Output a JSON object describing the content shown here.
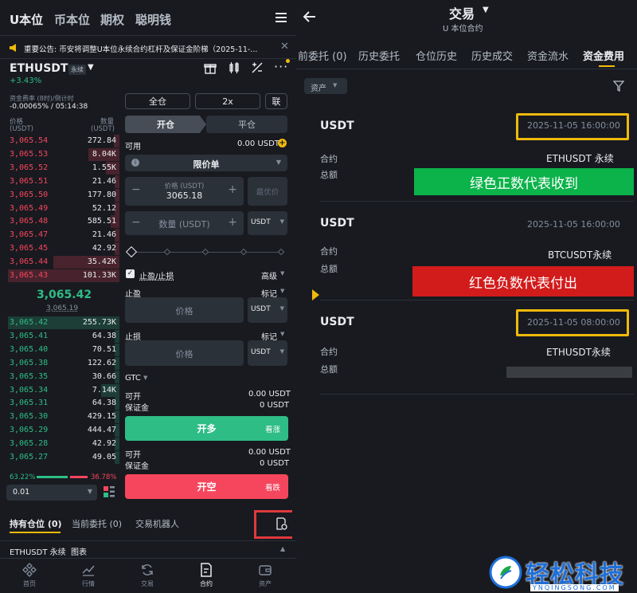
{
  "left": {
    "top_tabs": [
      "U本位",
      "币本位",
      "期权",
      "聪明钱"
    ],
    "announcement": "重要公告: 币安将调整U本位永续合约杠杆及保证金阶梯（2025-11-...",
    "symbol": "ETHUSDT",
    "symbol_badge": "永续",
    "change": "+3.43%",
    "funding_label": "资金费率 (8时)/倒计时",
    "funding_value": "-0.00065% / 05:14:38",
    "col_price": "价格",
    "col_price_unit": "(USDT)",
    "col_qty": "数量",
    "col_qty_unit": "(USDT)",
    "asks": [
      {
        "p": "3,065.54",
        "q": "272.84"
      },
      {
        "p": "3,065.53",
        "q": "8.04K"
      },
      {
        "p": "3,065.52",
        "q": "1.55K"
      },
      {
        "p": "3,065.51",
        "q": "21.46"
      },
      {
        "p": "3,065.50",
        "q": "177.80"
      },
      {
        "p": "3,065.49",
        "q": "52.12"
      },
      {
        "p": "3,065.48",
        "q": "585.51"
      },
      {
        "p": "3,065.47",
        "q": "21.46"
      },
      {
        "p": "3,065.45",
        "q": "42.92"
      },
      {
        "p": "3,065.44",
        "q": "35.42K"
      },
      {
        "p": "3,065.43",
        "q": "101.33K"
      }
    ],
    "mid_price": "3,065.42",
    "mark_price": "3,065.19",
    "bids": [
      {
        "p": "3,065.42",
        "q": "255.73K"
      },
      {
        "p": "3,065.41",
        "q": "64.38"
      },
      {
        "p": "3,065.40",
        "q": "70.51"
      },
      {
        "p": "3,065.38",
        "q": "122.62"
      },
      {
        "p": "3,065.35",
        "q": "30.66"
      },
      {
        "p": "3,065.34",
        "q": "7.14K"
      },
      {
        "p": "3,065.31",
        "q": "64.38"
      },
      {
        "p": "3,065.30",
        "q": "429.15"
      },
      {
        "p": "3,065.29",
        "q": "444.47"
      },
      {
        "p": "3,065.28",
        "q": "42.92"
      },
      {
        "p": "3,065.27",
        "q": "49.05"
      }
    ],
    "buy_ratio": "63.22%",
    "sell_ratio": "36.78%",
    "buy_ratio_value": 0.6322,
    "tick_size": "0.01",
    "margin_mode": "全仓",
    "leverage": "2x",
    "joint": "联",
    "open_tab": "开仓",
    "close_tab": "平仓",
    "available_label": "可用",
    "available_value": "0.00 USDT",
    "order_type": "限价单",
    "price_label": "价格 (USDT)",
    "price_value": "3065.18",
    "bbo": "最优价",
    "qty_placeholder": "数量 (USDT)",
    "qty_unit": "USDT",
    "tpsl_label": "止盈/止损",
    "advanced": "高级",
    "tp_label": "止盈",
    "mark_label": "标记",
    "tp_placeholder": "价格",
    "sl_label": "止损",
    "sl_placeholder": "价格",
    "tif": "GTC",
    "can_open": "可开",
    "can_open_value": "0.00 USDT",
    "margin": "保证金",
    "margin_value": "0 USDT",
    "long_btn": "开多",
    "long_hint": "看涨",
    "short_btn": "开空",
    "short_hint": "看跌",
    "bottom_tabs": [
      "持有仓位 (0)",
      "当前委托 (0)",
      "交易机器人"
    ],
    "chart_row": "ETHUSDT 永续  图表",
    "nav": [
      "首页",
      "行情",
      "交易",
      "合约",
      "资产"
    ]
  },
  "right": {
    "title": "交易",
    "subtitle": "U 本位合约",
    "tabs": [
      "前委托 (0)",
      "历史委托",
      "仓位历史",
      "历史成交",
      "资金流水",
      "资金费用"
    ],
    "filter": "资产",
    "label_contract": "合约",
    "label_amount": "总额",
    "records": [
      {
        "asset": "USDT",
        "time": "2025-11-05 16:00:00",
        "contract": "ETHUSDT 永续"
      },
      {
        "asset": "USDT",
        "time": "2025-11-05 16:00:00",
        "contract": "BTCUSDT永续"
      },
      {
        "asset": "USDT",
        "time": "2025-11-05 08:00:00",
        "contract": "ETHUSDT永续"
      }
    ],
    "green_note": "绿色正数代表收到",
    "red_note": "红色负数代表付出",
    "watermark": "轻松科技",
    "watermark_url": "YNQINGSONG.COM",
    "colors": {
      "green": "#0cb24a",
      "red": "#d21b1b",
      "highlight": "#f0b90b"
    }
  }
}
